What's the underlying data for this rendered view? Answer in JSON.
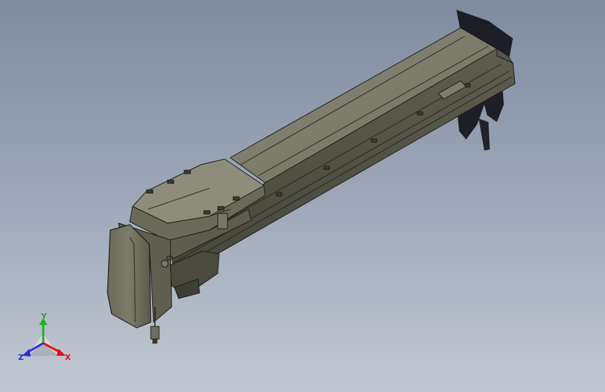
{
  "triad": {
    "x_label": "X",
    "y_label": "Y",
    "z_label": "Z",
    "x_color": "#e0101a",
    "y_color": "#22b022",
    "z_color": "#2530d8"
  },
  "colors": {
    "body": "#6f6e5d",
    "body_light": "#8a8a79",
    "body_dark": "#4e4e42",
    "edge": "#1c1c18",
    "shadow": "#141418"
  }
}
